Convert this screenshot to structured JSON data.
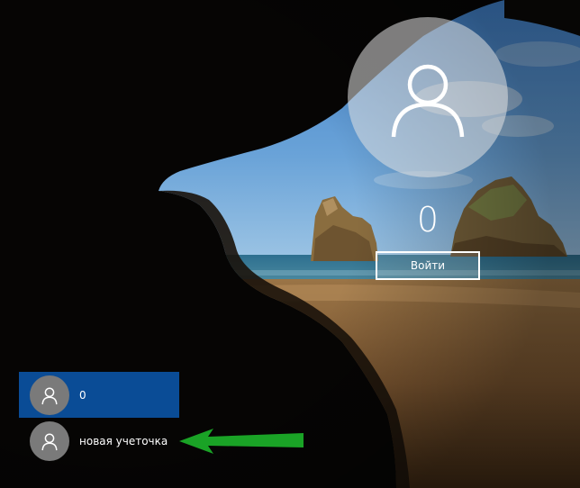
{
  "lock_screen": {
    "username": "0",
    "signin_button_label": "Войти",
    "avatar_icon": "user-icon"
  },
  "user_switcher": {
    "users": [
      {
        "name": "0",
        "avatar_icon": "user-icon",
        "selected": true
      },
      {
        "name": "новая учеточка",
        "avatar_icon": "user-icon",
        "selected": false
      }
    ]
  },
  "annotation": {
    "arrow_icon": "arrow-left-icon",
    "arrow_color": "#1aa326"
  },
  "colors": {
    "selected_tile": "#0a4c96",
    "avatar_circle": "#7a7a7a",
    "text": "#ffffff"
  }
}
